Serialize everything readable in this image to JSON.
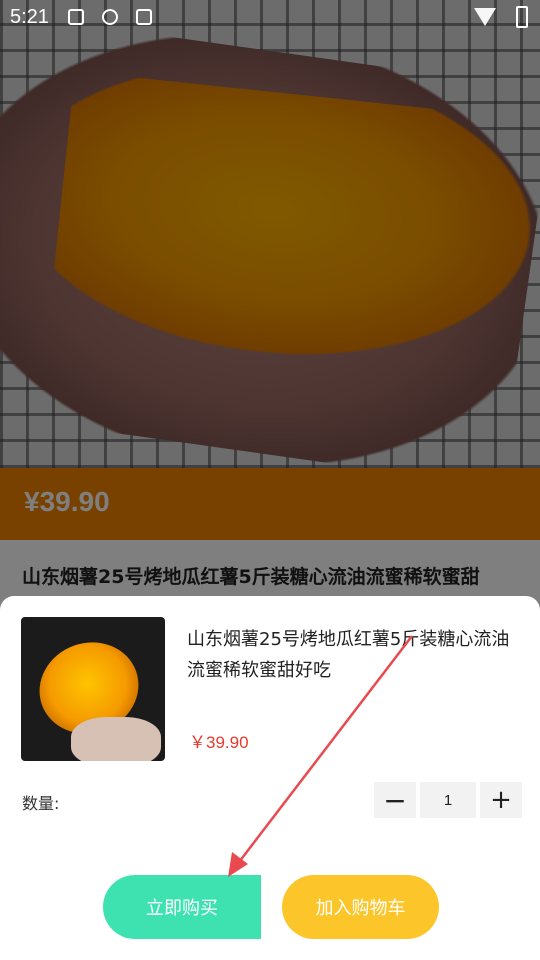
{
  "status_bar": {
    "time": "5:21",
    "icons": [
      "image-icon",
      "clock-icon",
      "a-icon",
      "wifi-icon",
      "battery-icon"
    ]
  },
  "background_page": {
    "price": "¥39.90",
    "title": "山东烟薯25号烤地瓜红薯5斤装糖心流油流蜜稀软蜜甜"
  },
  "sheet": {
    "product_title": "山东烟薯25号烤地瓜红薯5斤装糖心流油流蜜稀软蜜甜好吃",
    "price": "￥39.90",
    "quantity_label": "数量:",
    "quantity_value": "1",
    "minus_symbol": "−",
    "plus_symbol": "+",
    "buy_now_label": "立即购买",
    "add_to_cart_label": "加入购物车"
  },
  "colors": {
    "accent_orange": "#f08300",
    "price_red": "#e43b2c",
    "buy_green": "#3ee2b0",
    "cart_yellow": "#fcc62a",
    "annotation_arrow": "#e84a4f"
  }
}
